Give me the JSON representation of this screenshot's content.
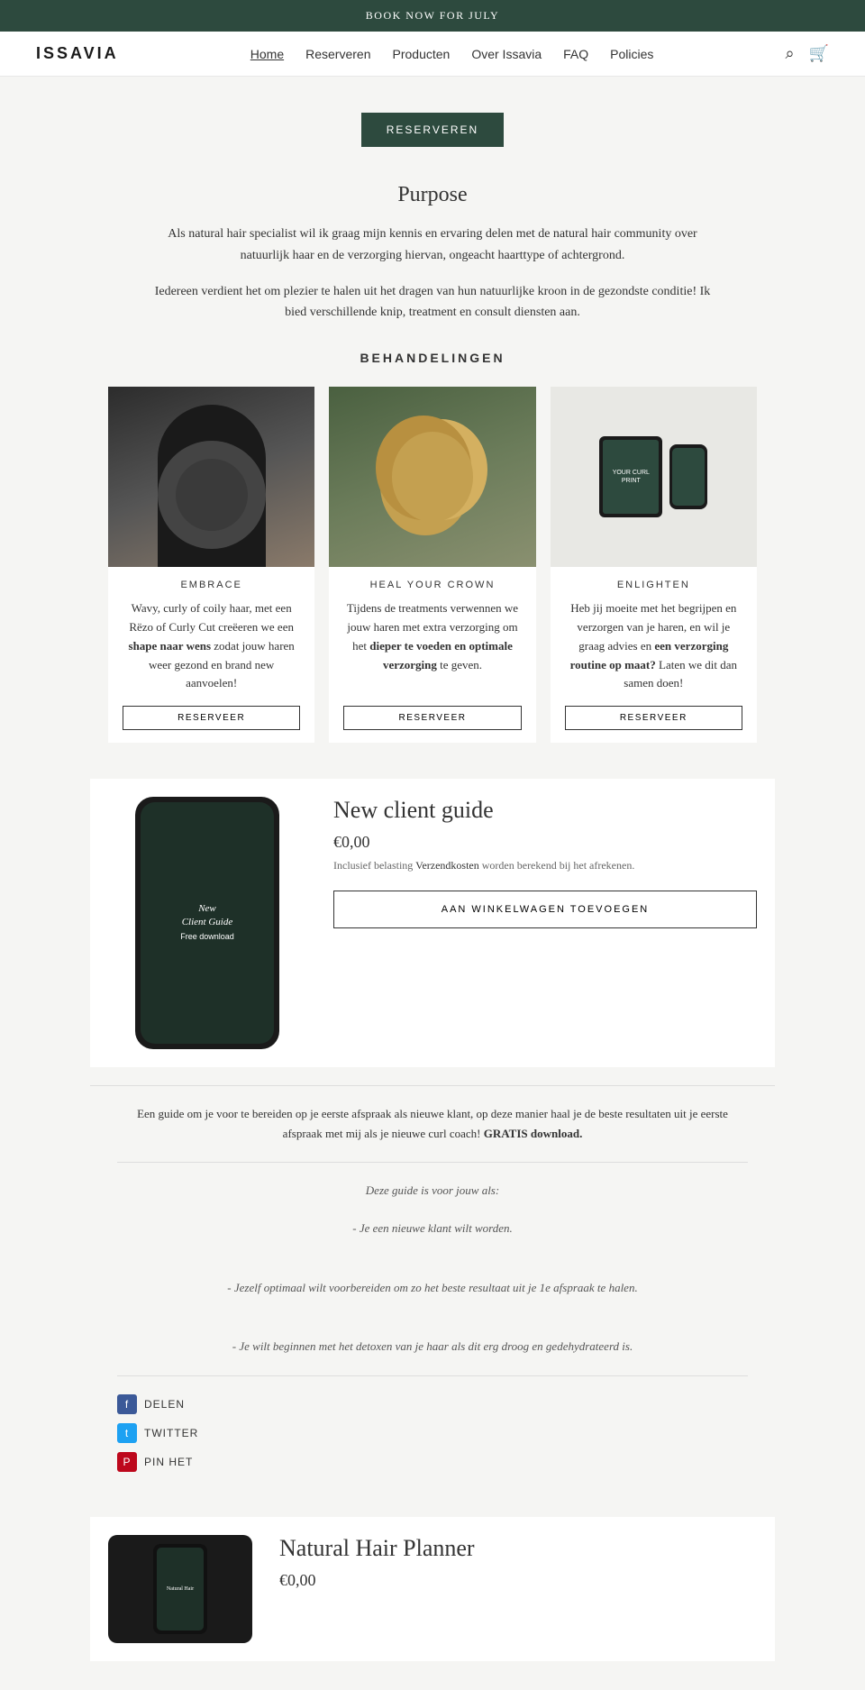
{
  "topBanner": {
    "text": "BOOK NOW FOR JULY"
  },
  "nav": {
    "logo": "ISSAVIA",
    "links": [
      {
        "label": "Home",
        "active": true
      },
      {
        "label": "Reserveren",
        "active": false
      },
      {
        "label": "Producten",
        "active": false
      },
      {
        "label": "Over Issavia",
        "active": false
      },
      {
        "label": "FAQ",
        "active": false
      },
      {
        "label": "Policies",
        "active": false
      }
    ]
  },
  "hero": {
    "button": "RESERVEREN"
  },
  "purpose": {
    "heading": "Purpose",
    "paragraph1": "Als natural hair specialist wil ik graag mijn kennis en ervaring delen met de natural hair community over natuurlijk haar en de verzorging hiervan, ongeacht haarttype of achtergrond.",
    "paragraph2": "Iedereen verdient het om plezier te halen uit het dragen van hun natuurlijke kroon in de gezondste conditie! Ik bied verschillende knip, treatment en consult diensten aan."
  },
  "behandelingen": {
    "heading": "BEHANDELINGEN",
    "cards": [
      {
        "id": "embrace",
        "title": "EMBRACE",
        "text": "Wavy, curly of coily haar, met een Rëzo of Curly Cut creëeren we een shape naar wens zodat jouw haren weer gezond en brand new aanvoelen!",
        "button": "RESERVEER"
      },
      {
        "id": "heal",
        "title": "HEAL YOUR CROWN",
        "text": "Tijdens de treatments verwennen we jouw haren met extra verzorging om het dieper te voeden en optimale verzorging te geven.",
        "button": "RESERVEER"
      },
      {
        "id": "enlighten",
        "title": "ENLIGHTEN",
        "text": "Heb jij moeite met het begrijpen en verzorgen van je haren, en wil je graag advies en een verzorging routine op maat? Laten we dit dan samen doen!",
        "button": "RESERVEER",
        "tabletLabel": "YOUR CURL PRINT"
      }
    ]
  },
  "product1": {
    "title": "New client guide",
    "price": "€0,00",
    "taxText": "Inclusief belasting",
    "taxLink": "Verzendkosten",
    "taxSuffix": "worden berekend bij het afrekenen.",
    "cartButton": "AAN WINKELWAGEN TOEVOEGEN",
    "phoneLabel": "New\nClient Guide\nFree download",
    "description": "Een guide om je voor te bereiden op je eerste afspraak als nieuwe klant, op deze manier haal je de beste resultaten uit je eerste afspraak met mij als je nieuwe curl coach! GRATIS download.",
    "listTitle": "Deze guide is voor jouw als:",
    "listItems": [
      "- Je een nieuwe klant wilt worden.",
      "- Jezelf optimaal wilt voorbereiden om zo het beste resultaat uit je 1e afspraak te halen.",
      "- Je wilt beginnen met het detoxen van je haar als dit erg droog en gedehydrateerd is."
    ]
  },
  "share": {
    "facebookLabel": "DELEN",
    "twitterLabel": "TWITTER",
    "pinterestLabel": "PIN HET"
  },
  "product2": {
    "title": "Natural Hair Planner",
    "price": "€0,00"
  }
}
